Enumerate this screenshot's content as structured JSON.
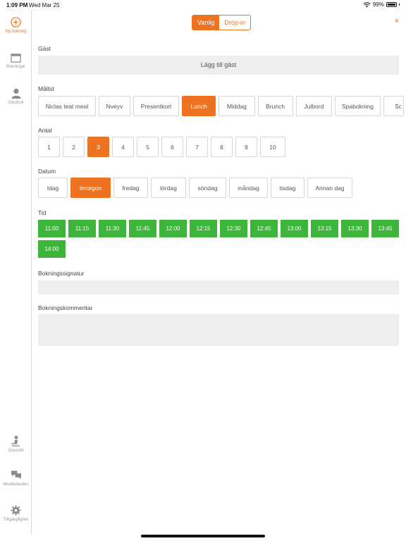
{
  "status": {
    "time": "1:09 PM",
    "date": "Wed Mar 25",
    "battery": "99%"
  },
  "sidebar": {
    "items": [
      {
        "label": "Ny bokning",
        "icon": "plus-circle-icon"
      },
      {
        "label": "Bokningar",
        "icon": "calendar-icon"
      },
      {
        "label": "Gästbok",
        "icon": "person-icon"
      },
      {
        "label": "Översikt",
        "icon": "waiter-icon"
      },
      {
        "label": "Meddelanden",
        "icon": "chat-icon"
      },
      {
        "label": "Tillgänglighet",
        "icon": "gear-icon"
      }
    ]
  },
  "header": {
    "segments": [
      "Vanlig",
      "Drop-in"
    ],
    "close": "×"
  },
  "guest": {
    "label": "Gäst",
    "button": "Lägg till gäst"
  },
  "meal": {
    "label": "Måltid",
    "options": [
      "Niclas teat meal",
      "Nveyv",
      "Presentkort",
      "Lunch",
      "Middag",
      "Brunch",
      "Julbord",
      "Spabokning",
      "Sc"
    ]
  },
  "count": {
    "label": "Antal",
    "options": [
      "1",
      "2",
      "3",
      "4",
      "5",
      "6",
      "7",
      "8",
      "9",
      "10"
    ]
  },
  "date": {
    "label": "Datum",
    "options": [
      "Idag",
      "Imorgon",
      "fredag",
      "lördag",
      "söndag",
      "måndag",
      "tisdag",
      "Annan dag"
    ]
  },
  "time": {
    "label": "Tid",
    "slots": [
      "11:00",
      "11:15",
      "11:30",
      "11:45",
      "12:00",
      "12:15",
      "12:30",
      "12:45",
      "13:00",
      "13:15",
      "13:30",
      "13:45",
      "14:00"
    ]
  },
  "signature": {
    "label": "Bokningssignatur",
    "value": ""
  },
  "comment": {
    "label": "Bokningskommentar",
    "value": ""
  },
  "colors": {
    "accent": "#ee7320",
    "available": "#3db43a",
    "field": "#eeeeee"
  }
}
